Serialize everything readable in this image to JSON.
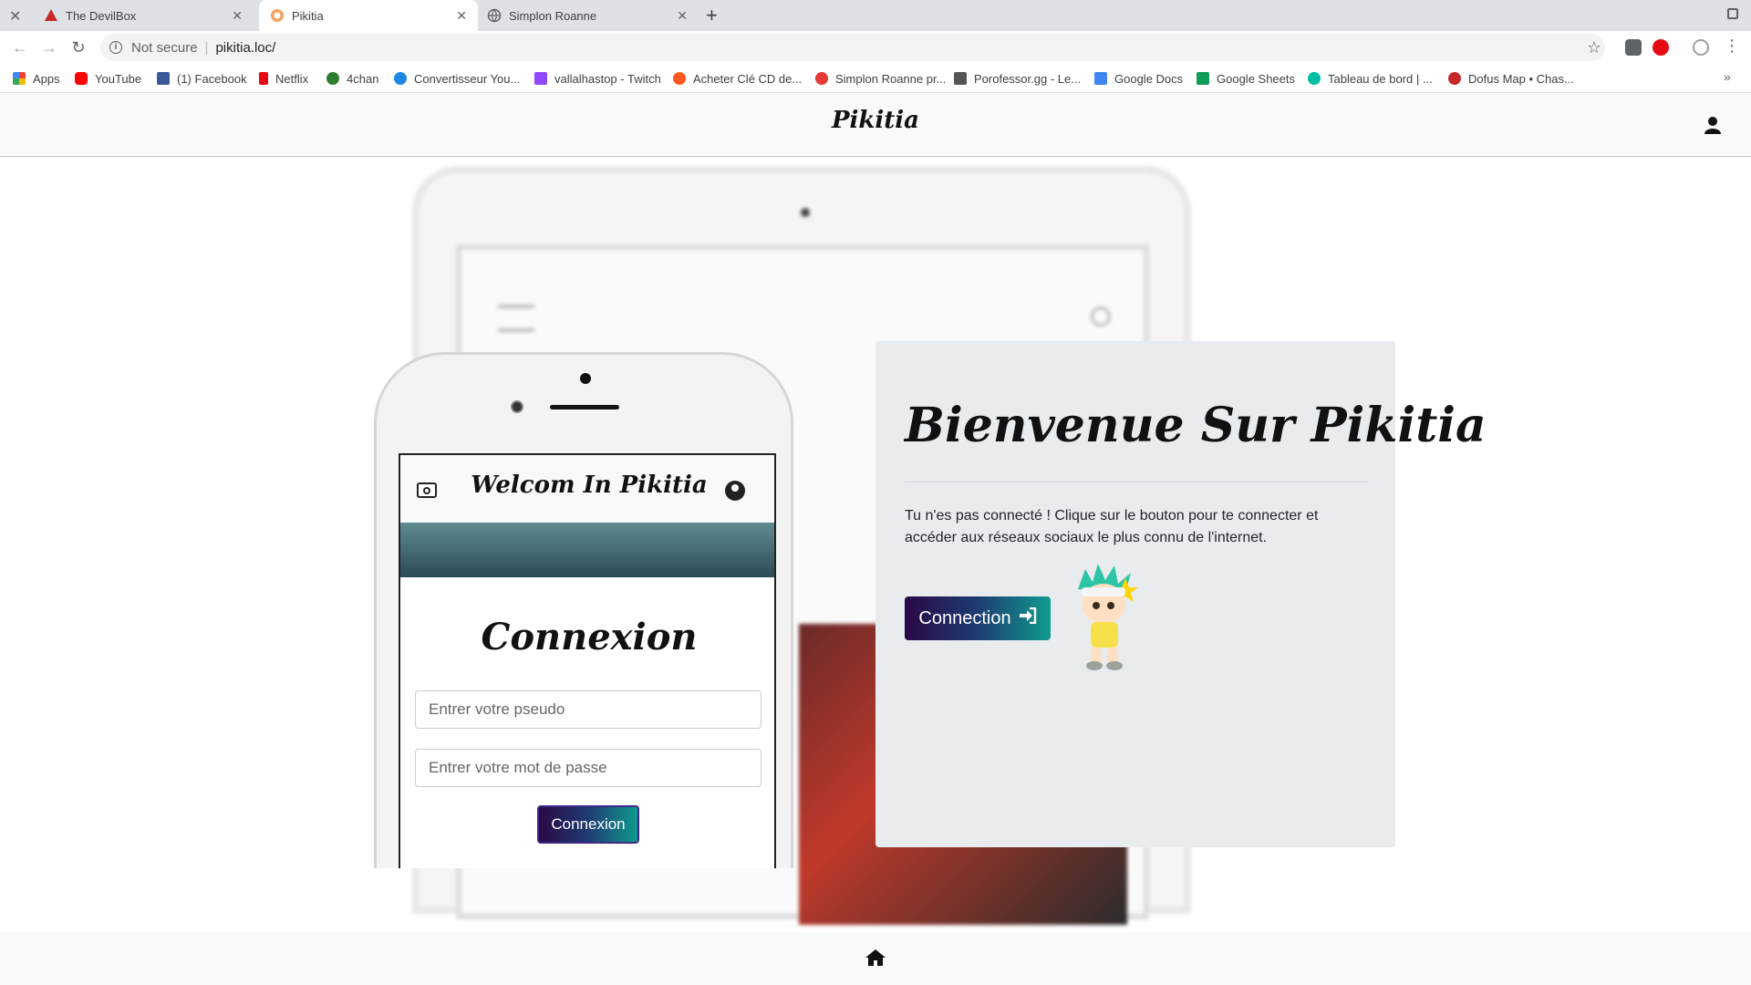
{
  "browser": {
    "tabs": [
      {
        "title": "The DevilBox",
        "active": false
      },
      {
        "title": "Pikitia",
        "active": true
      },
      {
        "title": "Simplon Roanne",
        "active": false
      }
    ],
    "security_label": "Not secure",
    "url": "pikitia.loc/",
    "bookmarks": [
      {
        "label": "Apps",
        "color": "#ea4335"
      },
      {
        "label": "YouTube",
        "color": "#ff0000"
      },
      {
        "label": "(1) Facebook",
        "color": "#3b5998"
      },
      {
        "label": "Netflix",
        "color": "#e50914"
      },
      {
        "label": "4chan",
        "color": "#2e7d32"
      },
      {
        "label": "Convertisseur You...",
        "color": "#1e88e5"
      },
      {
        "label": "vallalhastop - Twitch",
        "color": "#9146ff"
      },
      {
        "label": "Acheter Clé CD de...",
        "color": "#ff5722"
      },
      {
        "label": "Simplon Roanne pr...",
        "color": "#e53935"
      },
      {
        "label": "Porofessor.gg - Le...",
        "color": "#555555"
      },
      {
        "label": "Google Docs",
        "color": "#4285f4"
      },
      {
        "label": "Google Sheets",
        "color": "#0f9d58"
      },
      {
        "label": "Tableau de bord | ...",
        "color": "#00bfa5"
      },
      {
        "label": "Dofus Map • Chas...",
        "color": "#c62828"
      }
    ]
  },
  "site": {
    "brand": "Pikitia"
  },
  "phone": {
    "header_title": "Welcom In Pikitia",
    "form_title": "Connexion",
    "pseudo_placeholder": "Entrer votre pseudo",
    "password_placeholder": "Entrer votre mot de passe",
    "submit_label": "Connexion"
  },
  "card": {
    "title": "Bienvenue Sur Pikitia",
    "text": "Tu n'es pas connecté ! Clique sur le bouton pour te connecter et accéder aux réseaux sociaux le plus connu de l'internet.",
    "button_label": "Connection"
  },
  "colors": {
    "gradient_start": "#2a0845",
    "gradient_end": "#0f9b8e"
  }
}
